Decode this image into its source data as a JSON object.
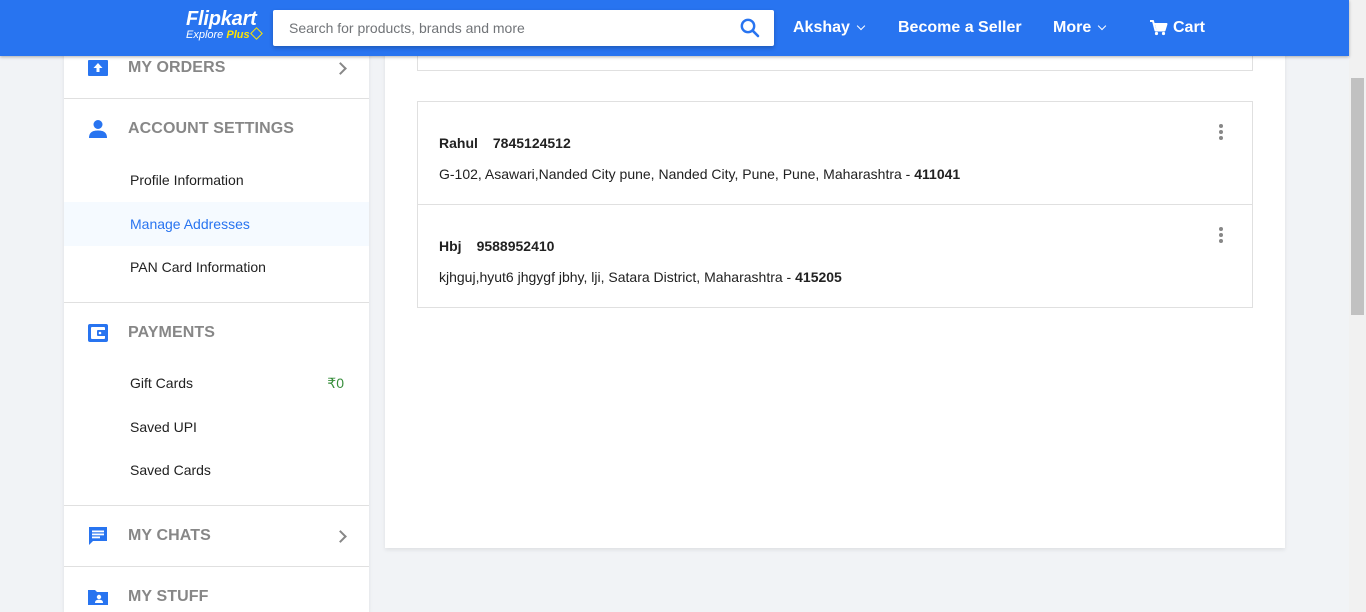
{
  "header": {
    "logo_text": "Flipkart",
    "logo_explore": "Explore",
    "logo_plus": "Plus",
    "search_placeholder": "Search for products, brands and more",
    "user_label": "Akshay",
    "seller_label": "Become a Seller",
    "more_label": "More",
    "cart_label": "Cart",
    "colors": {
      "brand": "#2874f0",
      "plus": "#ffe500"
    }
  },
  "sidebar": {
    "orders": {
      "title": "MY ORDERS",
      "icon": "orders-icon"
    },
    "account_settings": {
      "title": "ACCOUNT SETTINGS",
      "icon": "person-icon",
      "items": [
        {
          "label": "Profile Information",
          "active": false
        },
        {
          "label": "Manage Addresses",
          "active": true
        },
        {
          "label": "PAN Card Information",
          "active": false
        }
      ]
    },
    "payments": {
      "title": "PAYMENTS",
      "icon": "wallet-icon",
      "items": [
        {
          "label": "Gift Cards",
          "value": "₹0"
        },
        {
          "label": "Saved UPI"
        },
        {
          "label": "Saved Cards"
        }
      ]
    },
    "chats": {
      "title": "MY CHATS",
      "icon": "chat-icon"
    },
    "stuff": {
      "title": "MY STUFF",
      "icon": "folder-user-icon"
    }
  },
  "addresses": [
    {
      "name": "Rahul",
      "phone": "7845124512",
      "address": "G-102, Asawari,Nanded City pune, Nanded City, Pune, Pune, Maharashtra - ",
      "pincode": "411041"
    },
    {
      "name": "Hbj",
      "phone": "9588952410",
      "address": "kjhguj,hyut6 jhgygf jbhy, lji, Satara District, Maharashtra - ",
      "pincode": "415205"
    }
  ]
}
